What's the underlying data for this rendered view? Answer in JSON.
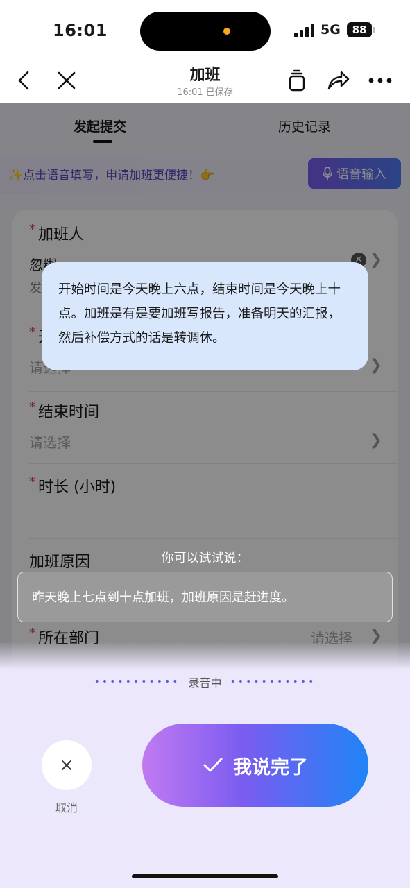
{
  "status_bar": {
    "time": "16:01",
    "network": "5G",
    "battery": "88"
  },
  "nav": {
    "title": "加班",
    "subtitle": "16:01 已保存"
  },
  "tabs": [
    {
      "label": "发起提交",
      "active": true
    },
    {
      "label": "历史记录",
      "active": false
    }
  ],
  "voice_banner": {
    "tip": "✨点击语音填写，申请加班更便捷！👉",
    "button_label": "语音输入"
  },
  "form": {
    "applicant": {
      "label": "加班人",
      "value": "忽糊",
      "sub": "发"
    },
    "start_time": {
      "label": "开始时间",
      "label_visible": "开",
      "placeholder": "请选择"
    },
    "end_time": {
      "label": "结束时间",
      "placeholder": "请选择"
    },
    "duration": {
      "label": "时长 (小时)"
    },
    "reason": {
      "label": "加班原因"
    },
    "department": {
      "label": "所在部门",
      "placeholder": "请选择"
    }
  },
  "transcript": "开始时间是今天晚上六点，结束时间是今天晚上十点。加班是有是要加班写报告，准备明天的汇报，然后补偿方式的话是转调休。",
  "hint": {
    "label": "你可以试试说：",
    "example": "昨天晚上七点到十点加班，加班原因是赶进度。"
  },
  "recording": {
    "label": "录音中",
    "dots": "•••••••••••"
  },
  "actions": {
    "cancel_label": "取消",
    "done_label": "我说完了"
  },
  "colors": {
    "accent_purple": "#7c5cf0",
    "accent_blue": "#1f84f6",
    "bubble": "#d8e7fb",
    "required": "#e5484d"
  }
}
